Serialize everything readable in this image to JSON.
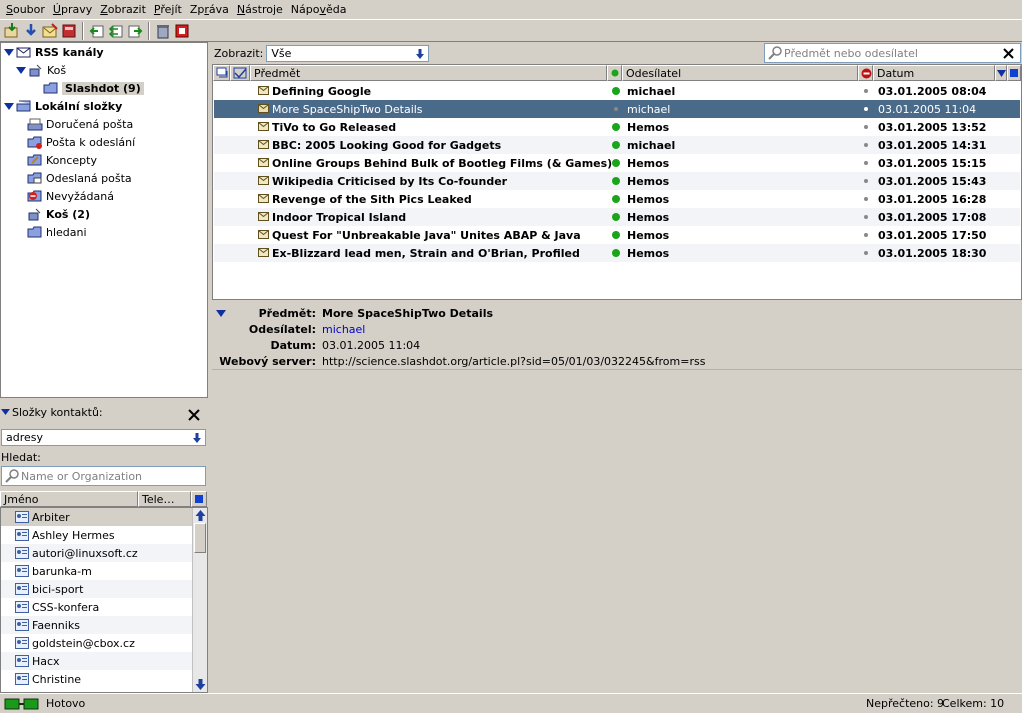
{
  "menu": [
    "Soubor",
    "Úpravy",
    "Zobrazit",
    "Přejít",
    "Zpráva",
    "Nástroje",
    "Nápověda"
  ],
  "menu_underline": [
    "S",
    "Ú",
    "Z",
    "P",
    "r",
    "N",
    "v"
  ],
  "toolbar_icons": [
    "get-mail-icon",
    "download-icon",
    "compose-icon",
    "address-book-icon",
    "reply-icon",
    "reply-all-icon",
    "forward-icon",
    "trash-icon",
    "stop-icon"
  ],
  "folders": {
    "rss_account": "RSS kanály",
    "rss_trash": "Koš",
    "rss_slashdot": "Slashdot (9)",
    "local_account": "Lokální složky",
    "inbox": "Doručená pošta",
    "outbox": "Pošta k odeslání",
    "drafts": "Koncepty",
    "sent": "Odeslaná pošta",
    "junk": "Nevyžádaná",
    "trash": "Koš (2)",
    "search": "hledani"
  },
  "contacts": {
    "title": "Složky kontaktů:",
    "book": "adresy",
    "search_label": "Hledat:",
    "search_placeholder": "Name or Organization",
    "col_name": "Jméno",
    "col_phone": "Tele…",
    "items": [
      "Arbiter",
      "Ashley Hermes",
      "autori@linuxsoft.cz",
      "barunka-m",
      "bici-sport",
      "CSS-konfera",
      "Faenniks",
      "goldstein@cbox.cz",
      "Hacx",
      "Christine"
    ]
  },
  "filter": {
    "label": "Zobrazit:",
    "value": "Vše",
    "search_placeholder": "Předmět nebo odesílatel"
  },
  "columns": {
    "subject": "Předmět",
    "sender": "Odesílatel",
    "date": "Datum"
  },
  "messages": [
    {
      "subject": "Defining Google",
      "sender": "michael",
      "date": "03.01.2005 08:04",
      "unread": true
    },
    {
      "subject": "More SpaceShipTwo Details",
      "sender": "michael",
      "date": "03.01.2005 11:04",
      "unread": false
    },
    {
      "subject": "TiVo to Go Released",
      "sender": "Hemos",
      "date": "03.01.2005 13:52",
      "unread": true
    },
    {
      "subject": "BBC:  2005 Looking Good for Gadgets",
      "sender": "michael",
      "date": "03.01.2005 14:31",
      "unread": true
    },
    {
      "subject": "Online Groups Behind Bulk of Bootleg Films (& Games)",
      "sender": "Hemos",
      "date": "03.01.2005 15:15",
      "unread": true
    },
    {
      "subject": "Wikipedia Criticised by Its Co-founder",
      "sender": "Hemos",
      "date": "03.01.2005 15:43",
      "unread": true
    },
    {
      "subject": "Revenge of the Sith Pics Leaked",
      "sender": "Hemos",
      "date": "03.01.2005 16:28",
      "unread": true
    },
    {
      "subject": "Indoor Tropical Island",
      "sender": "Hemos",
      "date": "03.01.2005 17:08",
      "unread": true
    },
    {
      "subject": "Quest For \"Unbreakable Java\" Unites ABAP & Java",
      "sender": "Hemos",
      "date": "03.01.2005 17:50",
      "unread": true
    },
    {
      "subject": "Ex-Blizzard lead men, Strain and O'Brian, Profiled",
      "sender": "Hemos",
      "date": "03.01.2005 18:30",
      "unread": true
    }
  ],
  "preview": {
    "subject_label": "Předmět:",
    "subject": "More SpaceShipTwo Details",
    "sender_label": "Odesílatel:",
    "sender": "michael",
    "date_label": "Datum:",
    "date": "03.01.2005 11:04",
    "server_label": "Webový server:",
    "server": "http://science.slashdot.org/article.pl?sid=05/01/03/032245&from=rss"
  },
  "status": {
    "text": "Hotovo",
    "unread": "Nepřečteno: 9",
    "total": "Celkem: 10"
  },
  "colors": {
    "selection": "#4a6a8a",
    "online_dot": "#1aa51a",
    "link": "#0000cc"
  }
}
